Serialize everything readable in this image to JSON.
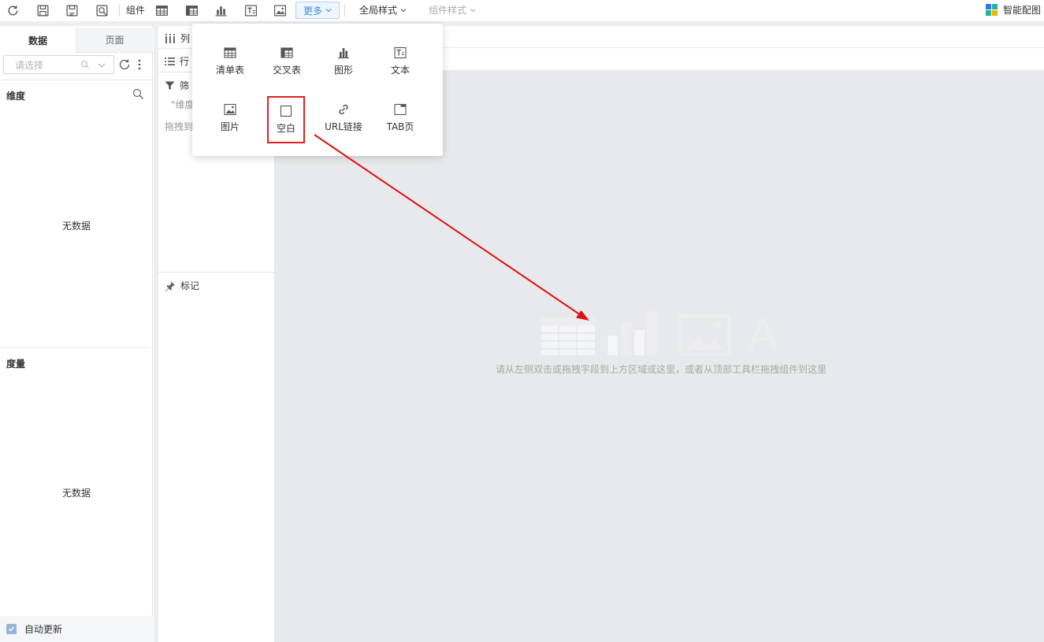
{
  "toolbar": {
    "components_label": "组件",
    "more_label": "更多",
    "global_style_label": "全局样式",
    "component_style_label": "组件样式",
    "smart_layout_label": "智能配图"
  },
  "left_panel": {
    "tabs": [
      {
        "label": "数据",
        "active": true
      },
      {
        "label": "页面",
        "active": false
      }
    ],
    "search_placeholder": "请选择",
    "dimension_title": "维度",
    "dimension_empty": "无数据",
    "measure_title": "度量",
    "measure_empty": "无数据",
    "auto_update_label": "自动更新",
    "auto_update_checked": true
  },
  "fields_panel": {
    "columns_label": "列",
    "rows_label": "行",
    "filter_label": "筛",
    "filter_hint": "\"维度",
    "drag_hint": "拖拽到",
    "marks_label": "标记"
  },
  "canvas": {
    "hint": "请从左侧双击或拖拽字段到上方区域或这里，或者从顶部工具栏拖拽组件到这里"
  },
  "more_menu": {
    "items": [
      {
        "label": "清单表",
        "icon": "list-table-icon"
      },
      {
        "label": "交叉表",
        "icon": "cross-table-icon"
      },
      {
        "label": "图形",
        "icon": "bar-chart-icon"
      },
      {
        "label": "文本",
        "icon": "text-icon"
      },
      {
        "label": "图片",
        "icon": "image-icon"
      },
      {
        "label": "空白",
        "icon": "blank-icon",
        "highlighted": true
      },
      {
        "label": "URL链接",
        "icon": "link-icon"
      },
      {
        "label": "TAB页",
        "icon": "tab-icon"
      }
    ]
  },
  "colors": {
    "accent": "#3a8ee6",
    "highlight_red": "#e02020",
    "canvas_bg": "#e7e9ec"
  }
}
